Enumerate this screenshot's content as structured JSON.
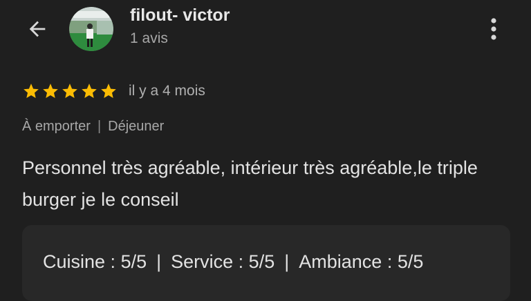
{
  "header": {
    "back_icon": "arrow-left-icon",
    "reviewer_name": "filout- victor",
    "review_count": "1 avis",
    "more_icon": "more-vert-icon"
  },
  "review": {
    "stars": 5,
    "star_color": "#fbbc04",
    "time": "il y a 4 mois",
    "tags": [
      "À emporter",
      "Déjeuner"
    ],
    "tag_separator": "|",
    "text": "Personnel très agréable, intérieur très agréable,le triple burger je le conseil"
  },
  "sub_ratings": {
    "separator": "|",
    "items": [
      {
        "label": "Cuisine",
        "value": "5/5"
      },
      {
        "label": "Service",
        "value": "5/5"
      },
      {
        "label": "Ambiance",
        "value": "5/5"
      }
    ]
  },
  "colors": {
    "background": "#1f1f1f",
    "panel": "#282828",
    "primary_text": "#e3e3e3",
    "secondary_text": "#a8a8a8"
  }
}
